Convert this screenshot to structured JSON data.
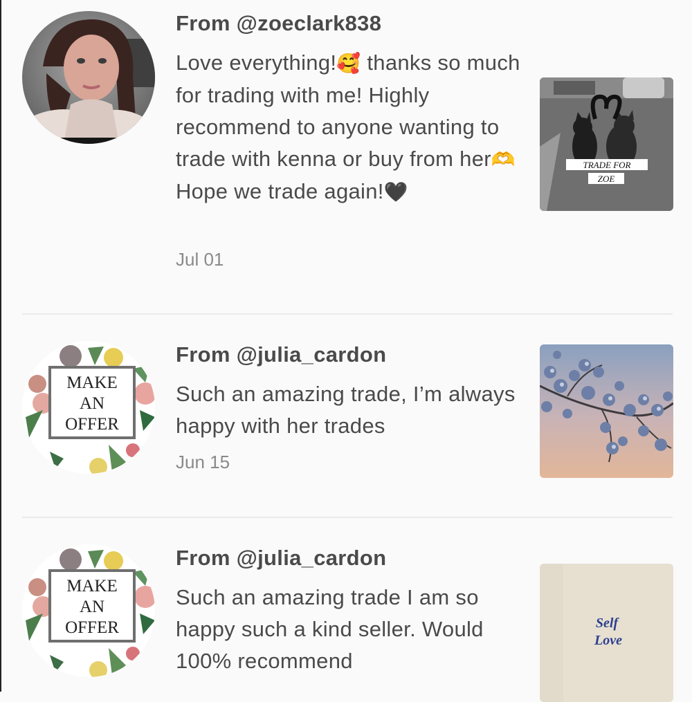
{
  "reviews": [
    {
      "from": "From @zoeclark838",
      "text_parts": [
        "Love everything!",
        "🥰",
        " thanks so much for trading with me! Highly recommend to anyone wanting to trade with kenna or buy from her",
        "🫶",
        " Hope we trade again!",
        "🖤"
      ],
      "date": "Jul 01",
      "avatar": "profile-photo",
      "thumb": {
        "type": "photo-cat",
        "label_line1": "TRADE FOR",
        "label_line2": "ZOE"
      }
    },
    {
      "from": "From @julia_cardon",
      "text": "Such an amazing trade, I’m always happy with her trades",
      "date": "Jun 15",
      "avatar": {
        "type": "make-an-offer",
        "line1": "MAKE",
        "line2": "AN",
        "line3": "OFFER"
      },
      "thumb": {
        "type": "photo-blossom"
      }
    },
    {
      "from": "From @julia_cardon",
      "text": "Such an amazing trade I am so happy such a kind seller. Would 100% recommend",
      "avatar": {
        "type": "make-an-offer",
        "line1": "MAKE",
        "line2": "AN",
        "line3": "OFFER"
      },
      "thumb": {
        "type": "self-love",
        "line1": "Self",
        "line2": "Love"
      }
    }
  ],
  "colors": {
    "background": "#fbfafa",
    "text": "#4a4a4a",
    "date": "#8a8a8a",
    "divider": "#ebe9e9"
  }
}
